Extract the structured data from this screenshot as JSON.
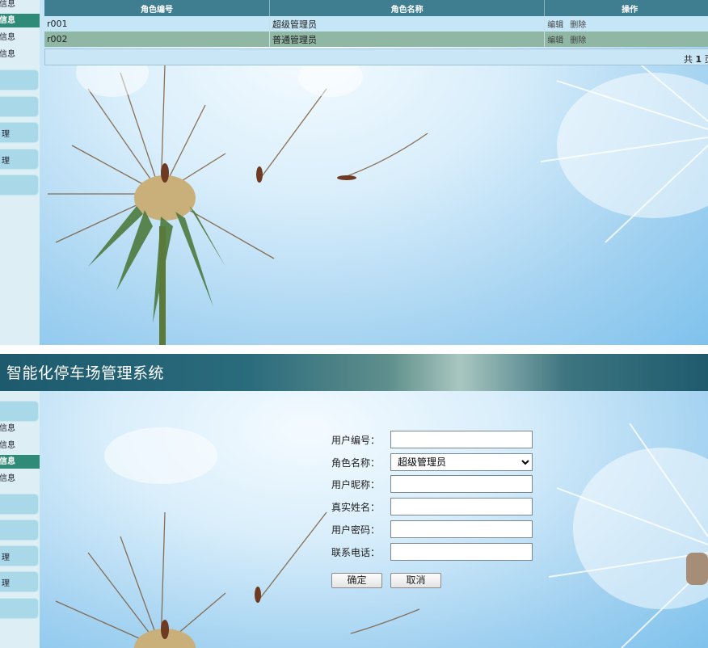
{
  "top_panel": {
    "sidebar": {
      "items": [
        {
          "label": "信息",
          "active": false
        },
        {
          "label": "信息",
          "active": true
        },
        {
          "label": "信息",
          "active": false
        },
        {
          "label": "信息",
          "active": false
        }
      ],
      "buttons": [
        "",
        "",
        "理",
        "理",
        ""
      ]
    },
    "table": {
      "headers": [
        "角色编号",
        "角色名称",
        "操作"
      ],
      "rows": [
        {
          "id": "r001",
          "name": "超级管理员",
          "edit": "编辑",
          "delete": "删除"
        },
        {
          "id": "r002",
          "name": "普通管理员",
          "edit": "编辑",
          "delete": "删除"
        }
      ]
    },
    "pager": {
      "prefix": "共",
      "count": "1",
      "suffix": "页"
    }
  },
  "bottom_panel": {
    "header_title": "智能化停车场管理系统",
    "sidebar": {
      "items": [
        {
          "label": "信息",
          "active": false
        },
        {
          "label": "信息",
          "active": false
        },
        {
          "label": "信息",
          "active": true
        },
        {
          "label": "信息",
          "active": false
        }
      ],
      "buttons": [
        "",
        "",
        "",
        "理",
        "理",
        ""
      ]
    },
    "form": {
      "user_id": {
        "label": "用户编号：",
        "value": ""
      },
      "role": {
        "label": "角色名称：",
        "selected": "超级管理员"
      },
      "nickname": {
        "label": "用户昵称：",
        "value": ""
      },
      "real_name": {
        "label": "真实姓名：",
        "value": ""
      },
      "password": {
        "label": "用户密码：",
        "value": ""
      },
      "phone": {
        "label": "联系电话：",
        "value": ""
      },
      "confirm_label": "确定",
      "cancel_label": "取消"
    }
  },
  "colors": {
    "header_bg": "#3f7d90",
    "active_item": "#2f8a77",
    "row_a": "#c5e6f7",
    "row_b": "#8fb7a3"
  }
}
